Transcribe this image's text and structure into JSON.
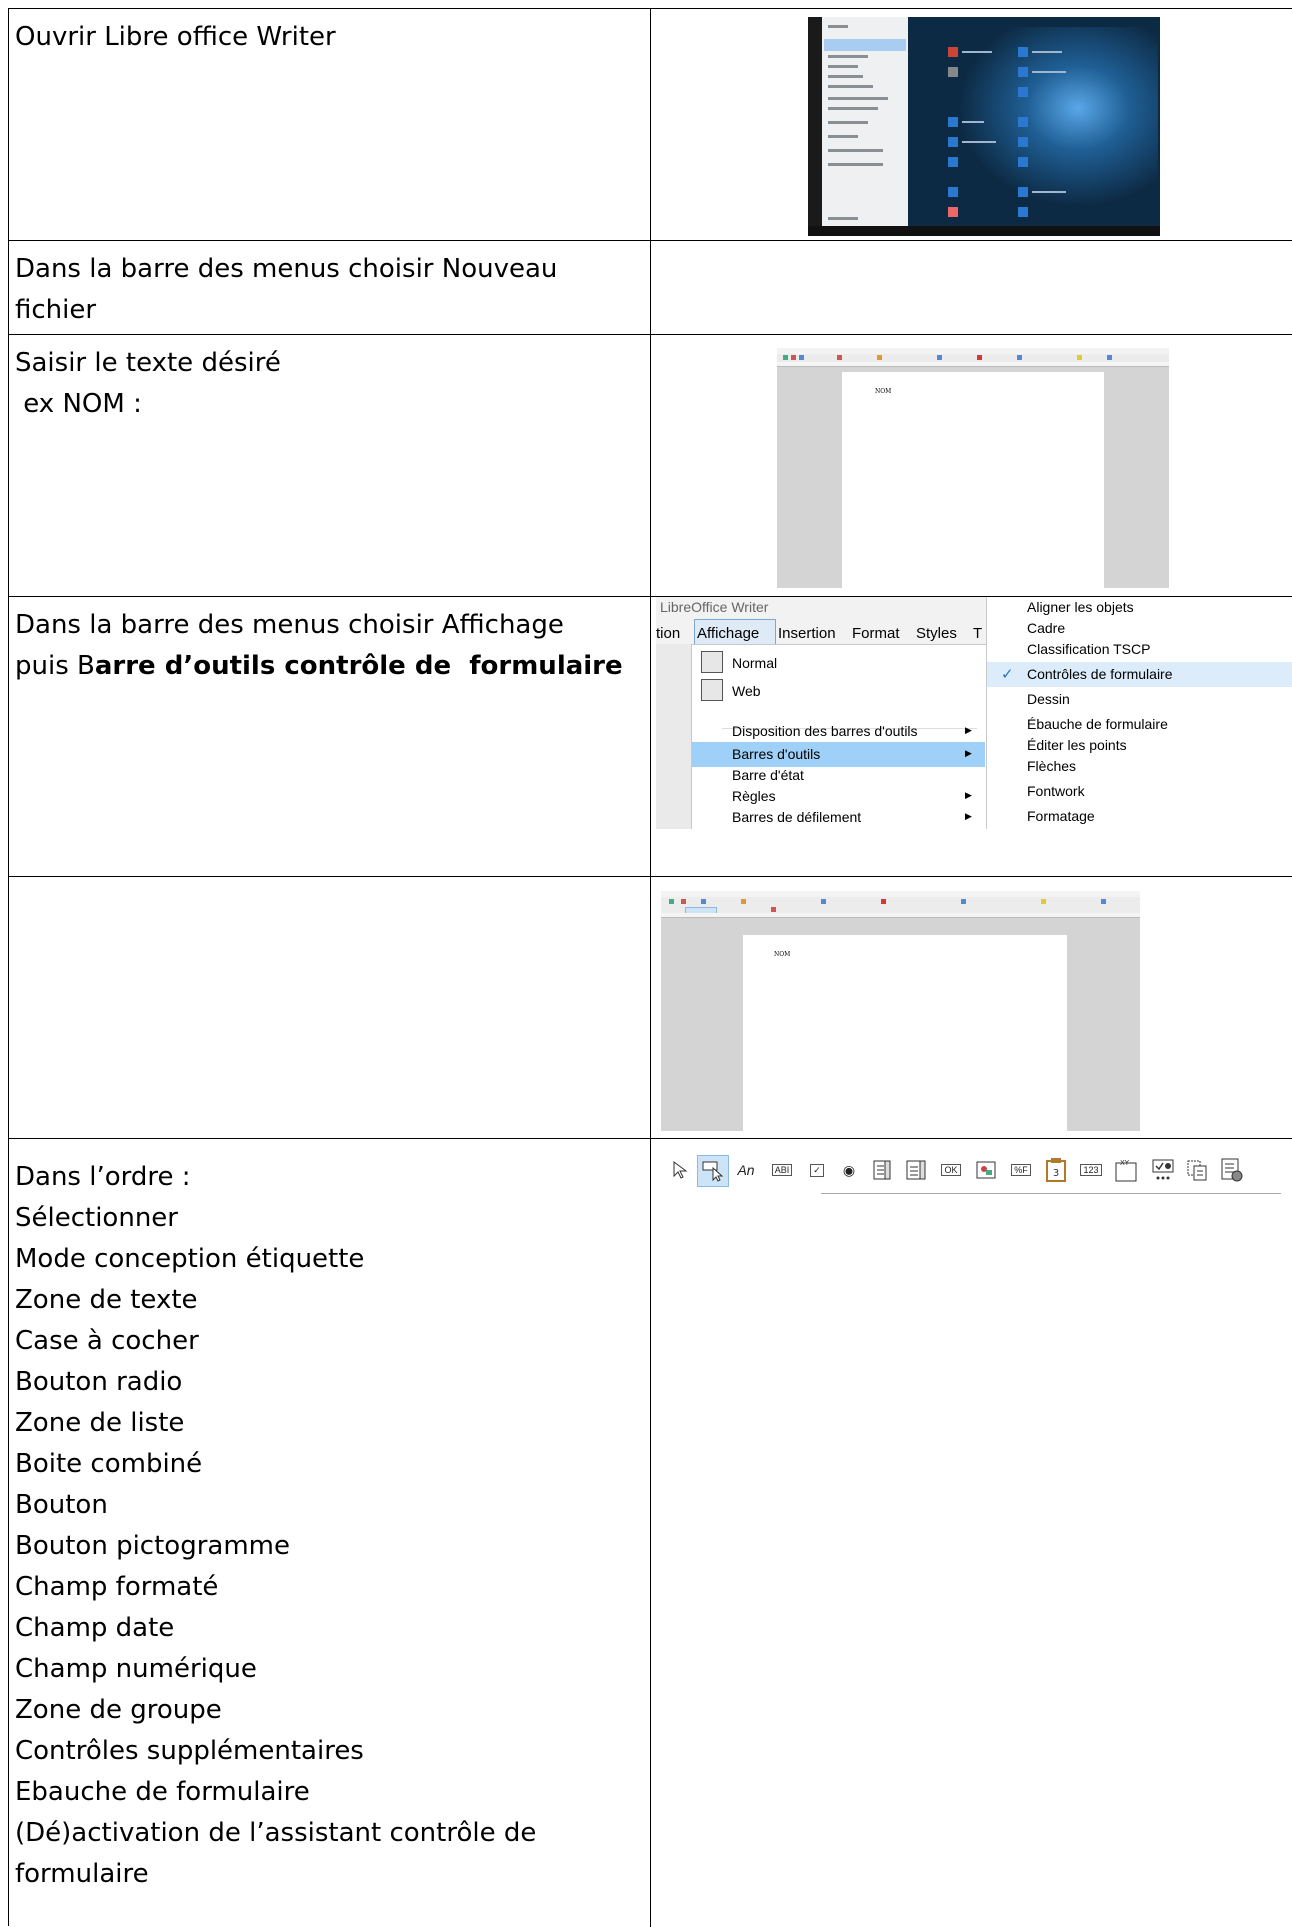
{
  "rows": [
    {
      "lines": [
        "Ouvrir Libre office Writer"
      ]
    },
    {
      "lines": [
        "Dans la barre des menus choisir Nouveau",
        "fichier"
      ]
    },
    {
      "lines": [
        "Saisir le texte désiré",
        " ex NOM :"
      ]
    },
    {
      "line1": "Dans la barre des menus choisir Affichage",
      "line2_pre": "puis B",
      "line2_bold": "arre d’outils contrôle de  formulaire"
    },
    {
      "lines": []
    },
    {
      "lines": [
        "Dans l’ordre :",
        "Sélectionner",
        "Mode conception étiquette",
        "Zone de texte",
        "Case à cocher",
        "Bouton radio",
        "Zone de liste",
        "Boite combiné",
        "Bouton",
        "Bouton pictogramme",
        "Champ formaté",
        "Champ date",
        "Champ numérique",
        "Zone de groupe",
        "Contrôles supplémentaires",
        "Ebauche de formulaire",
        "(Dé)activation de l’assistant contrôle de",
        "formulaire"
      ]
    }
  ],
  "writer_doc_text": "NOM",
  "libreoffice_menu": {
    "window_title": "LibreOffice Writer",
    "menubar": [
      "tion",
      "Affichage",
      "Insertion",
      "Format",
      "Styles",
      "T"
    ],
    "view_menu": [
      "Normal",
      "Web",
      "Disposition des barres d'outils",
      "Barres d'outils",
      "Barre d'état",
      "Règles",
      "Barres de défilement"
    ],
    "toolbars_submenu": [
      "Aligner les objets",
      "Cadre",
      "Classification TSCP",
      "Contrôles de formulaire",
      "Dessin",
      "Ébauche de formulaire",
      "Éditer les points",
      "Flèches",
      "Fontwork",
      "Formatage"
    ],
    "checked_item": "Contrôles de formulaire",
    "checkmark": "✓"
  },
  "toolbar": {
    "label_btn": "An",
    "text_box": "ABI",
    "checkbox": "✓",
    "radio": "◉",
    "push_button": "OK",
    "formatted": "%F",
    "date": "3",
    "numeric": "123",
    "group": "XY"
  }
}
